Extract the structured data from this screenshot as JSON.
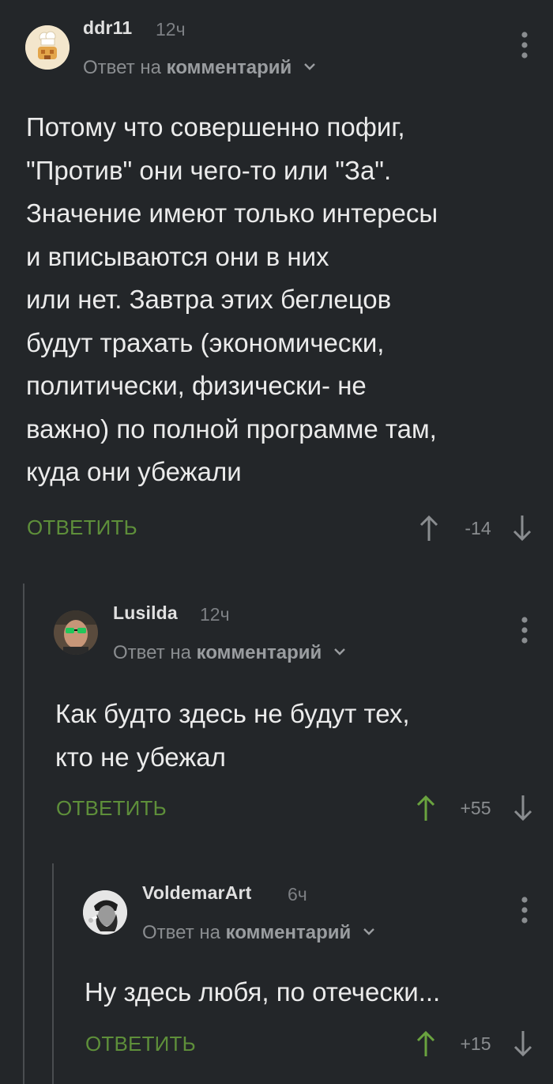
{
  "colors": {
    "background": "#232629",
    "reply_green": "#5e8f3a",
    "upvote_active": "#6aa33f",
    "muted": "#8a8d90",
    "branch_line": "#4a4d50"
  },
  "comments": [
    {
      "author": "ddr11",
      "time": "12ч",
      "avatar_icon": "baker-avatar",
      "reply_prefix": "Ответ на",
      "reply_link": "комментарий",
      "text": "Потому что совершенно пофиг,\n\"Против\" они чего-то или \"За\".\nЗначение имеют только интересы\nи вписываются  они  в них\nили нет. Завтра этих беглецов\nбудут трахать (экономически,\nполитически, физически- не\nважно) по полной программе  там,\nкуда они убежали",
      "reply_label": "ОТВЕТИТЬ",
      "rating": "-14",
      "upvoted": false
    },
    {
      "author": "Lusilda",
      "time": "12ч",
      "avatar_icon": "sunglasses-avatar",
      "reply_prefix": "Ответ на",
      "reply_link": "комментарий",
      "text": "Как будто здесь не будут тех,\nкто не убежал",
      "reply_label": "ОТВЕТИТЬ",
      "rating": "+55",
      "upvoted": true
    },
    {
      "author": "VoldemarArt",
      "time": "6ч",
      "avatar_icon": "che-portrait-avatar",
      "reply_prefix": "Ответ на",
      "reply_link": "комментарий",
      "text": "Ну здесь любя, по отечески...",
      "reply_label": "ОТВЕТИТЬ",
      "rating": "+15",
      "upvoted": true
    }
  ]
}
